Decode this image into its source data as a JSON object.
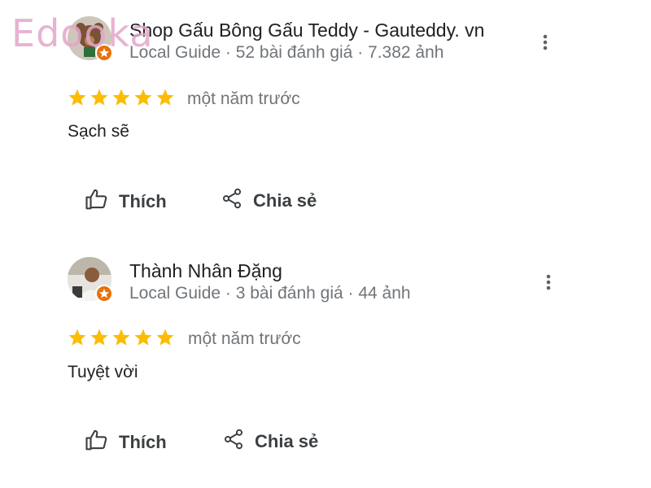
{
  "watermark": "Edooka",
  "actions_labels": {
    "like": "Thích",
    "share": "Chia sẻ"
  },
  "reviews": [
    {
      "author": "Shop Gấu Bông Gấu Teddy - Gauteddy. vn",
      "meta": "Local Guide · 52 bài đánh giá · 7.382 ảnh",
      "rating": 5,
      "max_rating": 5,
      "time": "một năm trước",
      "text": "Sạch sẽ"
    },
    {
      "author": "Thành Nhân Đặng",
      "meta": "Local Guide · 3 bài đánh giá · 44 ảnh",
      "rating": 5,
      "max_rating": 5,
      "time": "một năm trước",
      "text": "Tuyệt vời"
    }
  ],
  "colors": {
    "star": "#fbbc04",
    "badge": "#e8710a",
    "watermark": "#e3a6c9"
  }
}
